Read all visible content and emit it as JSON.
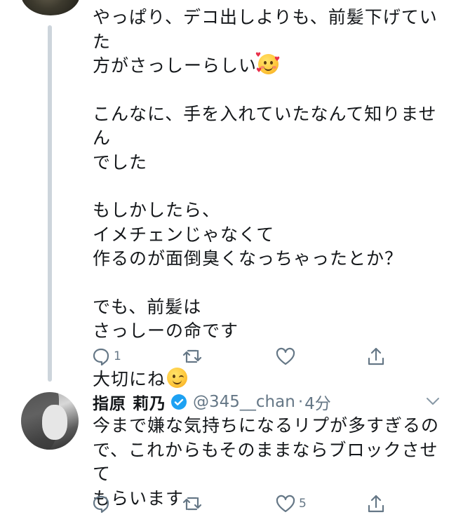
{
  "tweet1": {
    "lines": [
      "やっぱり、デコ出しよりも、前髪下げていた",
      "方がさっしーらしい",
      "こんなに、手を入れていたなんて知りません",
      "でした",
      "もしかしたら、",
      "イメチェンじゃなくて",
      "作るのが面倒臭くなっちゃったとか？",
      "でも、前髪は",
      "さっしーの命です",
      "大切にね"
    ],
    "emoji_1": "smiling-face-with-hearts",
    "emoji_2": "winking-face",
    "actions": {
      "reply_count": "1",
      "retweet_count": "",
      "like_count": ""
    }
  },
  "tweet2": {
    "display_name": "指原 莉乃",
    "verified": true,
    "handle": "@345__chan",
    "separator": "·",
    "time": "4分",
    "lines": [
      "今まで嫌な気持ちになるリプが多すぎるの",
      "で、これからもそのままならブロックさせて",
      "もらいます"
    ],
    "actions": {
      "reply_count": "",
      "retweet_count": "",
      "like_count": "5"
    }
  },
  "colors": {
    "text": "#14171a",
    "muted": "#657786",
    "verified": "#1da1f2",
    "thread_line": "#cdd5dc"
  }
}
